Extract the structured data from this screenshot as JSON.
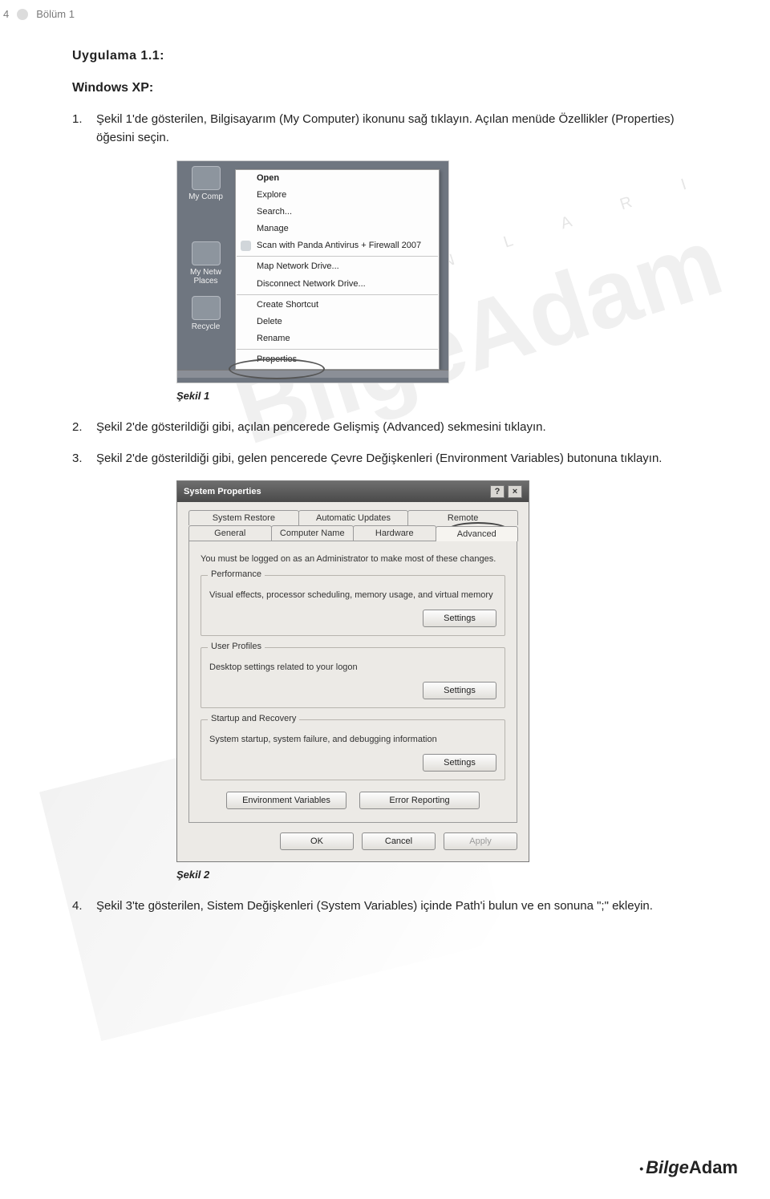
{
  "header": {
    "page_number": "4",
    "chapter": "Bölüm 1"
  },
  "section": {
    "title": "Uygulama 1.1:",
    "subtitle": "Windows XP:"
  },
  "steps": [
    {
      "n": "1.",
      "text": "Şekil 1'de gösterilen, Bilgisayarım (My Computer) ikonunu sağ tıklayın. Açılan menüde Özellikler (Properties) öğesini seçin."
    },
    {
      "n": "2.",
      "text": "Şekil 2'de gösterildiği gibi, açılan pencerede Gelişmiş (Advanced) sekmesini tıklayın."
    },
    {
      "n": "3.",
      "text": "Şekil 2'de gösterildiği gibi, gelen pencerede Çevre Değişkenleri (Environment Variables) butonuna tıklayın."
    },
    {
      "n": "4.",
      "text": "Şekil 3'te gösterilen, Sistem Değişkenleri (System Variables) içinde Path'i bulun ve en sonuna \";\" ekleyin."
    }
  ],
  "fig1": {
    "caption": "Şekil 1",
    "desktop_icons": [
      {
        "label": "My Comp"
      },
      {
        "label": "My Netw Places"
      },
      {
        "label": "Recycle"
      }
    ],
    "menu": [
      {
        "label": "Open",
        "bold": true
      },
      {
        "label": "Explore"
      },
      {
        "label": "Search..."
      },
      {
        "label": "Manage"
      },
      {
        "label": "Scan with Panda Antivirus + Firewall 2007",
        "icon": true
      },
      {
        "sep": true
      },
      {
        "label": "Map Network Drive..."
      },
      {
        "label": "Disconnect Network Drive..."
      },
      {
        "sep": true
      },
      {
        "label": "Create Shortcut"
      },
      {
        "label": "Delete"
      },
      {
        "label": "Rename"
      },
      {
        "sep": true
      },
      {
        "label": "Properties"
      }
    ]
  },
  "fig2": {
    "caption": "Şekil 2",
    "title": "System Properties",
    "tabs_row1": [
      "System Restore",
      "Automatic Updates",
      "Remote"
    ],
    "tabs_row2": [
      "General",
      "Computer Name",
      "Hardware",
      "Advanced"
    ],
    "active_tab": "Advanced",
    "notice": "You must be logged on as an Administrator to make most of these changes.",
    "groups": [
      {
        "legend": "Performance",
        "desc": "Visual effects, processor scheduling, memory usage, and virtual memory",
        "btn": "Settings"
      },
      {
        "legend": "User Profiles",
        "desc": "Desktop settings related to your logon",
        "btn": "Settings"
      },
      {
        "legend": "Startup and Recovery",
        "desc": "System startup, system failure, and debugging information",
        "btn": "Settings"
      }
    ],
    "env_button": "Environment Variables",
    "error_button": "Error Reporting",
    "ok": "OK",
    "cancel": "Cancel",
    "apply": "Apply"
  },
  "footer": {
    "brand_pre": "Bilge",
    "brand_post": "Adam"
  },
  "watermark": "BilgeAdam",
  "wm_letters": "Y A Y I N L A R I"
}
